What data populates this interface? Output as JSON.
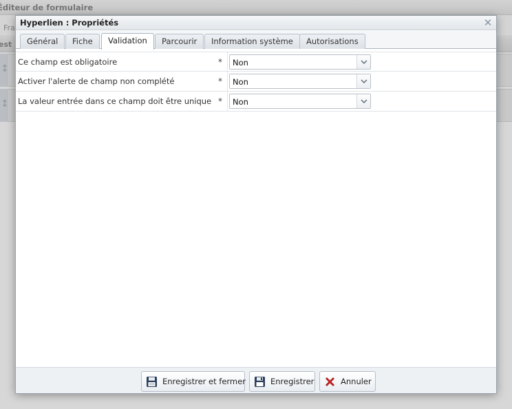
{
  "background": {
    "window_title": "Éditeur de formulaire",
    "toolbar_text": "Fra",
    "subbar_text": "est"
  },
  "dialog": {
    "title": "Hyperlien : Propriétés",
    "close_icon": "close-icon",
    "tabs": [
      {
        "label": "Général",
        "active": false
      },
      {
        "label": "Fiche",
        "active": false
      },
      {
        "label": "Validation",
        "active": true
      },
      {
        "label": "Parcourir",
        "active": false
      },
      {
        "label": "Information système",
        "active": false
      },
      {
        "label": "Autorisations",
        "active": false
      }
    ],
    "fields": [
      {
        "label": "Ce champ est obligatoire",
        "required_mark": "*",
        "value": "Non"
      },
      {
        "label": "Activer l'alerte de champ non complété",
        "required_mark": "*",
        "value": "Non"
      },
      {
        "label": "La valeur entrée dans ce champ doit être unique",
        "required_mark": "*",
        "value": "Non"
      }
    ],
    "buttons": {
      "save_close": {
        "label": "Enregistrer et fermer",
        "icon": "save-close-icon"
      },
      "save": {
        "label": "Enregistrer",
        "icon": "floppy-disk-icon"
      },
      "cancel": {
        "label": "Annuler",
        "icon": "red-x-icon"
      }
    }
  },
  "colors": {
    "accent_border": "#aab4be",
    "cancel_red": "#d42020",
    "floppy_blue": "#2c3e5a"
  }
}
